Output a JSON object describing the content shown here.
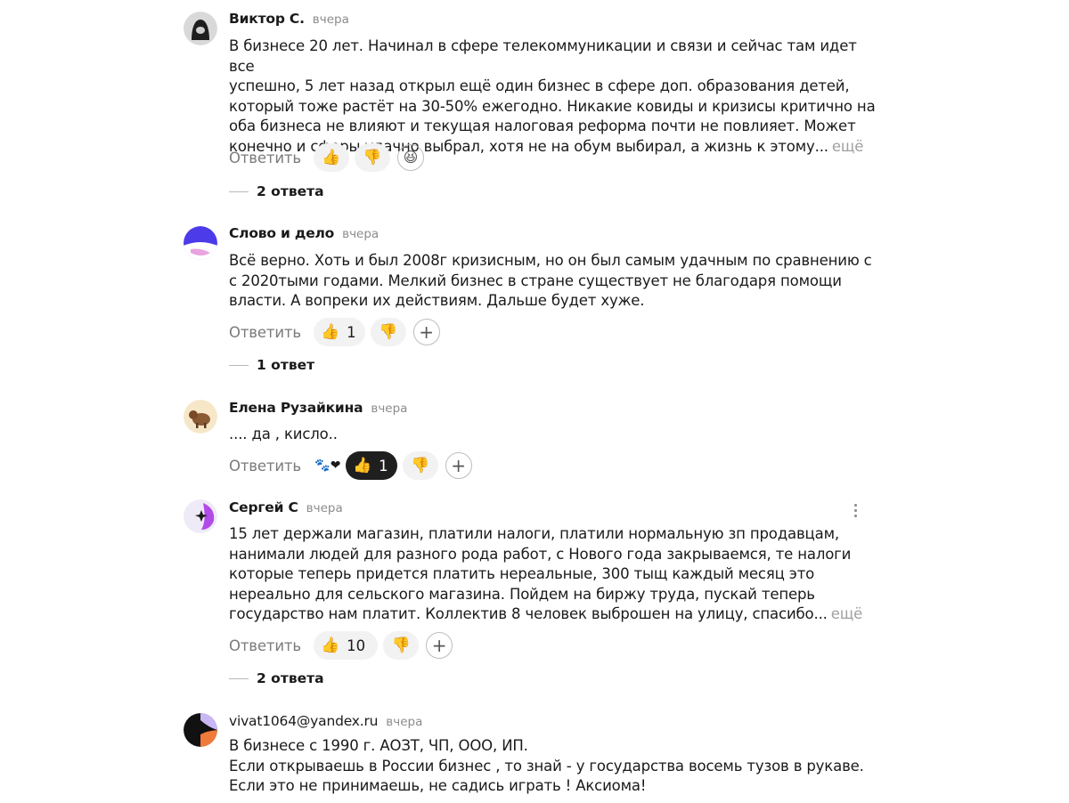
{
  "reply_label": "Ответить",
  "more_label": "ещё",
  "comments": [
    {
      "author": "Виктор С.",
      "time": "вчера",
      "lines": [
        "В бизнесе 20 лет. Начинал в сфере телекоммуникации и связи и сейчас там идет все",
        "успешно, 5 лет назад открыл ещё один бизнес в сфере доп. образования детей,",
        "который тоже растёт на 30-50% ежегодно. Никакие ковиды и кризисы критично на",
        "оба бизнеса не влияют и текущая налоговая реформа почти не повлияет. Может",
        "конечно и сферы удачно выбрал, хотя не на обум выбирал, а жизнь к этому..."
      ],
      "likes": "",
      "replies": "2 ответа"
    },
    {
      "author": "Слово и дело",
      "time": "вчера",
      "lines": [
        "Всё верно. Хоть и был 2008г кризисным, но он был самым удачным по сравнению с",
        "с 2020тыми годами. Мелкий бизнес в стране существует не благодаря помощи",
        "власти. А вопреки их действиям. Дальше будет хуже."
      ],
      "likes": "1",
      "replies": "1 ответ"
    },
    {
      "author": "Елена Рузайкина",
      "time": "вчера",
      "lines": [
        ".... да , кисло.."
      ],
      "likes": "1"
    },
    {
      "author": "Сергей С",
      "time": "вчера",
      "lines": [
        "15 лет держали магазин, платили налоги, платили нормальную зп продавцам,",
        "нанимали людей для разного рода работ, с Нового года закрываемся, те налоги",
        "которые теперь придется платить нереальные, 300 тыщ каждый месяц это",
        "нереально для сельского магазина. Пойдем на биржу труда, пускай теперь",
        "государство нам платит. Коллектив 8 человек выброшен на улицу, спасибо..."
      ],
      "likes": "10",
      "replies": "2 ответа"
    },
    {
      "author": "vivat1064@yandex.ru",
      "time": "вчера",
      "lines": [
        "В бизнесе с 1990 г. АОЗТ, ЧП, ООО, ИП.",
        "Если открываешь в России бизнес , то знай - у государства восемь тузов в рукаве.",
        "Если это не принимаешь, не садись играть ! Аксиома!"
      ]
    }
  ],
  "icons": {
    "like": "thumbs-up-icon",
    "dislike": "thumbs-down-icon",
    "add_reaction": "plus-icon",
    "laugh": "laughing-face-icon",
    "heart_reaction": "heart-reaction-icon",
    "menu": "more-vertical-icon"
  },
  "colors": {
    "text": "#1a1a1a",
    "muted": "#8c8c8c",
    "pill_bg": "#f2f2f2",
    "pill_active_bg": "#1f1f1f",
    "avatar_slovo": "#4b3be8",
    "avatar_sergey": "#b14be8",
    "avatar_vivat": "#f07a3a"
  }
}
